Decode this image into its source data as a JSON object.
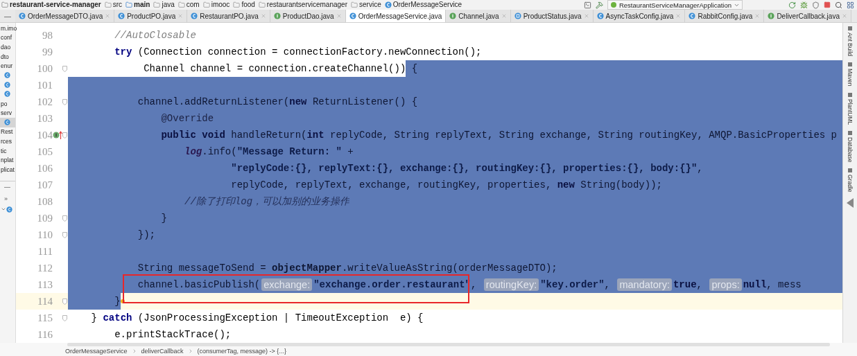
{
  "breadcrumbs": [
    {
      "label": "restaurant-service-manager",
      "kind": "project"
    },
    {
      "label": "src",
      "kind": "folder"
    },
    {
      "label": "main",
      "kind": "source_root"
    },
    {
      "label": "java",
      "kind": "folder"
    },
    {
      "label": "com",
      "kind": "folder"
    },
    {
      "label": "imooc",
      "kind": "folder"
    },
    {
      "label": "food",
      "kind": "folder"
    },
    {
      "label": "restaurantservicemanager",
      "kind": "folder"
    },
    {
      "label": "service",
      "kind": "folder"
    },
    {
      "label": "OrderMessageService",
      "kind": "class"
    }
  ],
  "tab_bar_control": "—",
  "run_configuration": "RestaurantServiceManagerApplication",
  "tabs": [
    {
      "label": "OrderMessageDTO.java",
      "kind": "class",
      "selected": false
    },
    {
      "label": "ProductPO.java",
      "kind": "class",
      "selected": false
    },
    {
      "label": "RestaurantPO.java",
      "kind": "class",
      "selected": false
    },
    {
      "label": "ProductDao.java",
      "kind": "interface",
      "selected": false
    },
    {
      "label": "OrderMessageService.java",
      "kind": "class",
      "selected": true
    },
    {
      "label": "Channel.java",
      "kind": "interface",
      "selected": false
    },
    {
      "label": "ProductStatus.java",
      "kind": "enum",
      "selected": false
    },
    {
      "label": "AsyncTaskConfig.java",
      "kind": "class",
      "selected": false
    },
    {
      "label": "RabbitConfig.java",
      "kind": "class",
      "selected": false
    },
    {
      "label": "DeliverCallback.java",
      "kind": "interface",
      "selected": false
    }
  ],
  "project_tree": [
    {
      "label": "m.imo",
      "kind": "folder",
      "selected": false
    },
    {
      "label": "conf",
      "kind": "folder",
      "selected": false
    },
    {
      "label": "dao",
      "kind": "folder",
      "selected": false
    },
    {
      "label": "dto",
      "kind": "folder",
      "selected": false
    },
    {
      "label": "enur",
      "kind": "folder",
      "selected": false
    },
    {
      "kind": "class",
      "selected": false
    },
    {
      "kind": "class",
      "selected": false
    },
    {
      "kind": "class",
      "selected": false
    },
    {
      "label": "po",
      "kind": "folder",
      "selected": false
    },
    {
      "label": "serv",
      "kind": "folder",
      "selected": false
    },
    {
      "kind": "class",
      "selected": true
    },
    {
      "label": "Rest",
      "kind": "folder",
      "selected": false
    },
    {
      "label": "rces",
      "kind": "folder",
      "selected": false
    },
    {
      "label": "tic",
      "kind": "folder",
      "selected": false
    },
    {
      "label": "nplat",
      "kind": "folder",
      "selected": false
    },
    {
      "label": "plicat",
      "kind": "folder",
      "selected": false
    }
  ],
  "panel_controls": [
    "—",
    "»"
  ],
  "code_lines": [
    {
      "number": "98",
      "current": false,
      "boxed": false,
      "fold": false,
      "marker": false,
      "selected_to_end": false,
      "segments": [
        {
          "kind": "comment",
          "text": "        //AutoClosable",
          "selected": false
        }
      ]
    },
    {
      "number": "99",
      "current": false,
      "boxed": false,
      "fold": false,
      "marker": false,
      "selected_to_end": false,
      "segments": [
        {
          "kind": "keyword",
          "text": "        try",
          "selected": false
        },
        {
          "kind": "plain",
          "text": " (Connection connection = connectionFactory.newConnection();",
          "selected": false
        }
      ]
    },
    {
      "number": "100",
      "current": false,
      "boxed": false,
      "fold": true,
      "marker": false,
      "selected_to_end": true,
      "segments": [
        {
          "kind": "plain",
          "text": "             Channel channel = connection.createChannel())",
          "selected": false
        },
        {
          "kind": "plain",
          "text": " {",
          "selected": true
        }
      ]
    },
    {
      "number": "101",
      "current": false,
      "boxed": false,
      "fold": false,
      "marker": false,
      "selected_to_end": true
    },
    {
      "number": "102",
      "current": false,
      "boxed": false,
      "fold": true,
      "marker": false,
      "selected_to_end": true,
      "segments": [
        {
          "kind": "plain",
          "text": "            channel.addReturnListener(",
          "selected": true
        },
        {
          "kind": "keyword",
          "text": "new",
          "selected": true
        },
        {
          "kind": "plain",
          "text": " ReturnListener() {",
          "selected": true
        }
      ]
    },
    {
      "number": "103",
      "current": false,
      "boxed": false,
      "fold": false,
      "marker": false,
      "selected_to_end": true,
      "segments": [
        {
          "kind": "annotation",
          "text": "                @Override",
          "selected": true
        }
      ]
    },
    {
      "number": "104",
      "current": false,
      "boxed": false,
      "fold": true,
      "marker": true,
      "selected_to_end": true,
      "segments": [
        {
          "kind": "keyword",
          "text": "                public void",
          "selected": true
        },
        {
          "kind": "plain",
          "text": " handleReturn(",
          "selected": true
        },
        {
          "kind": "keyword",
          "text": "int",
          "selected": true
        },
        {
          "kind": "plain",
          "text": " replyCode, String replyText, String exchange, String routingKey, AMQP.BasicProperties p",
          "selected": true
        }
      ]
    },
    {
      "number": "105",
      "current": false,
      "boxed": false,
      "fold": false,
      "marker": false,
      "selected_to_end": true,
      "segments": [
        {
          "kind": "field",
          "text": "                    log",
          "selected": true
        },
        {
          "kind": "plain",
          "text": ".info(",
          "selected": true
        },
        {
          "kind": "string",
          "text": "\"Message Return: \"",
          "selected": true
        },
        {
          "kind": "plain",
          "text": " +",
          "selected": true
        }
      ]
    },
    {
      "number": "106",
      "current": false,
      "boxed": false,
      "fold": false,
      "marker": false,
      "selected_to_end": true,
      "segments": [
        {
          "kind": "string",
          "text": "                            \"replyCode:{}, replyText:{}, exchange:{}, routingKey:{}, properties:{}, body:{}\"",
          "selected": true
        },
        {
          "kind": "plain",
          "text": ",",
          "selected": true
        }
      ]
    },
    {
      "number": "107",
      "current": false,
      "boxed": false,
      "fold": false,
      "marker": false,
      "selected_to_end": true,
      "segments": [
        {
          "kind": "plain",
          "text": "                            replyCode, replyText, exchange, routingKey, properties, ",
          "selected": true
        },
        {
          "kind": "keyword",
          "text": "new",
          "selected": true
        },
        {
          "kind": "plain",
          "text": " String(body));",
          "selected": true
        }
      ]
    },
    {
      "number": "108",
      "current": false,
      "boxed": false,
      "fold": false,
      "marker": false,
      "selected_to_end": true,
      "segments": [
        {
          "kind": "comment",
          "text": "                    //除了打印log，可以加别的业务操作",
          "selected": true
        }
      ]
    },
    {
      "number": "109",
      "current": false,
      "boxed": false,
      "fold": true,
      "marker": false,
      "selected_to_end": true,
      "segments": [
        {
          "kind": "plain",
          "text": "                }",
          "selected": true
        }
      ]
    },
    {
      "number": "110",
      "current": false,
      "boxed": false,
      "fold": true,
      "marker": false,
      "selected_to_end": true,
      "segments": [
        {
          "kind": "plain",
          "text": "            });",
          "selected": true
        }
      ]
    },
    {
      "number": "111",
      "current": false,
      "boxed": false,
      "fold": false,
      "marker": false,
      "selected_to_end": true
    },
    {
      "number": "112",
      "current": false,
      "boxed": false,
      "fold": false,
      "marker": false,
      "selected_to_end": true,
      "segments": [
        {
          "kind": "plain",
          "text": "            String messageToSend = ",
          "selected": true
        },
        {
          "kind": "bold",
          "text": "objectMapper",
          "selected": true
        },
        {
          "kind": "plain",
          "text": ".writeValueAsString(orderMessageDTO);",
          "selected": true
        }
      ]
    },
    {
      "number": "113",
      "current": false,
      "boxed": true,
      "fold": false,
      "marker": false,
      "selected_to_end": true,
      "segments": [
        {
          "kind": "plain",
          "text": "            channel.basicPublish(",
          "selected": true
        },
        {
          "kind": "hint",
          "text": "exchange:",
          "selected": true
        },
        {
          "kind": "string",
          "text": "\"exchange.order.restaurant\"",
          "selected": true
        },
        {
          "kind": "plain",
          "text": ", ",
          "selected": true
        },
        {
          "kind": "hint",
          "text": "routingKey:",
          "selected": true
        },
        {
          "kind": "string",
          "text": "\"key.order\"",
          "selected": true
        },
        {
          "kind": "plain",
          "text": ", ",
          "selected": true
        },
        {
          "kind": "hint",
          "text": "mandatory:",
          "selected": true
        },
        {
          "kind": "keyword",
          "text": "true",
          "selected": true
        },
        {
          "kind": "plain",
          "text": ", ",
          "selected": true
        },
        {
          "kind": "hint",
          "text": "props:",
          "selected": true
        },
        {
          "kind": "keyword",
          "text": "null",
          "selected": true
        },
        {
          "kind": "plain",
          "text": ", mess",
          "selected": true
        }
      ]
    },
    {
      "number": "114",
      "current": true,
      "boxed": true,
      "fold": true,
      "marker": false,
      "selected_to_end": false,
      "segments": [
        {
          "kind": "plain",
          "text": "        }",
          "selected": true
        }
      ]
    },
    {
      "number": "115",
      "current": false,
      "boxed": false,
      "fold": true,
      "marker": false,
      "selected_to_end": false,
      "segments": [
        {
          "kind": "plain",
          "text": "    } ",
          "selected": false
        },
        {
          "kind": "keyword",
          "text": "catch",
          "selected": false
        },
        {
          "kind": "plain",
          "text": " (JsonProcessingException | TimeoutException  e) {",
          "selected": false
        }
      ]
    },
    {
      "number": "116",
      "current": false,
      "boxed": false,
      "fold": false,
      "marker": false,
      "selected_to_end": false,
      "segments": [
        {
          "kind": "plain",
          "text": "        e.printStackTrace();",
          "selected": false
        }
      ]
    }
  ],
  "tool_windows": [
    "Ant Build",
    "Maven",
    "PlantUML",
    "Database",
    "Gradle"
  ],
  "status_breadcrumbs": [
    "OrderMessageService",
    "deliverCallback",
    "(consumerTag, message) -> {...}"
  ]
}
